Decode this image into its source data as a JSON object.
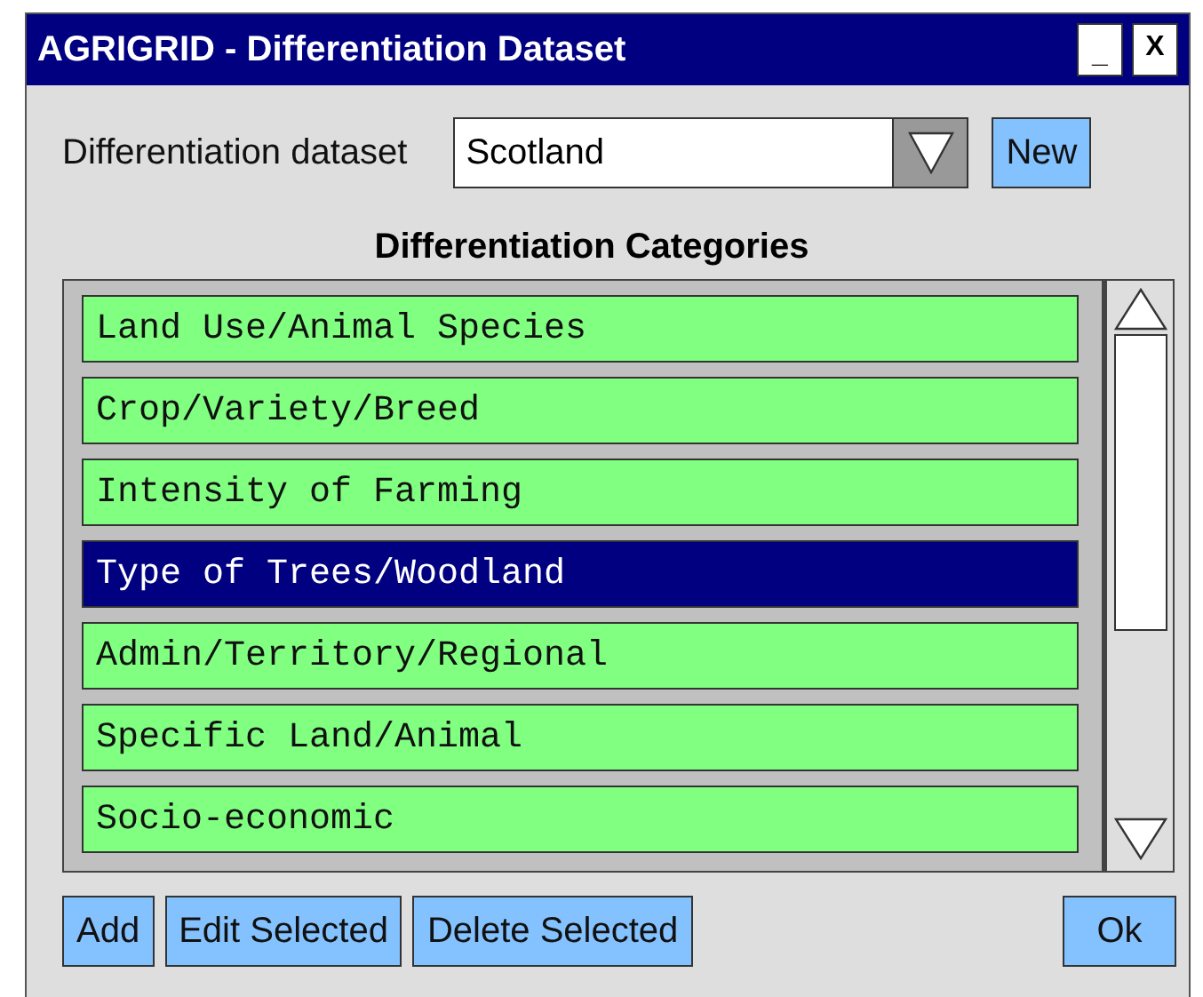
{
  "window": {
    "title": "AGRIGRID - Differentiation Dataset",
    "controls": [
      "_",
      "X"
    ]
  },
  "dataset": {
    "label": "Differentiation dataset",
    "value": "Scotland",
    "new_button": "New"
  },
  "categories": {
    "heading": "Differentiation Categories",
    "items": [
      {
        "label": "Land Use/Animal Species",
        "selected": false
      },
      {
        "label": "Crop/Variety/Breed",
        "selected": false
      },
      {
        "label": "Intensity of Farming",
        "selected": false
      },
      {
        "label": "Type of Trees/Woodland",
        "selected": true
      },
      {
        "label": "Admin/Territory/Regional",
        "selected": false
      },
      {
        "label": "Specific Land/Animal",
        "selected": false
      },
      {
        "label": "Socio-economic",
        "selected": false
      }
    ]
  },
  "buttons": [
    "Add",
    "Edit Selected",
    "Delete Selected"
  ],
  "ok_button": "Ok"
}
